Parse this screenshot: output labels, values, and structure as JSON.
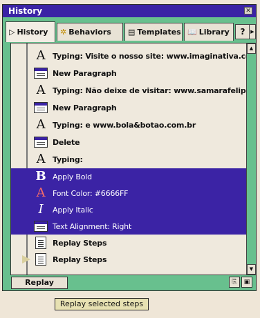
{
  "window": {
    "title": "History",
    "close_glyph": "✕"
  },
  "tabs": [
    {
      "label": "History",
      "icon": "play-triangle-icon",
      "glyph": "▷"
    },
    {
      "label": "Behaviors",
      "icon": "gear-icon",
      "glyph": "✲"
    },
    {
      "label": "Templates",
      "icon": "template-icon",
      "glyph": "▤"
    },
    {
      "label": "Library",
      "icon": "book-icon",
      "glyph": "📖"
    }
  ],
  "help": {
    "glyph": "?"
  },
  "tab_scroll": {
    "glyph": "▶"
  },
  "history_items": [
    {
      "label": "Typing: Visite o nosso site: www.imaginativa.com.br",
      "icon": "typing-icon",
      "selected": false
    },
    {
      "label": "New Paragraph",
      "icon": "paragraph-icon",
      "selected": false
    },
    {
      "label": "Typing: Não deixe de visitar: www.samarafelippo.com.br",
      "icon": "typing-icon",
      "selected": false
    },
    {
      "label": "New Paragraph",
      "icon": "paragraph-icon",
      "selected": false
    },
    {
      "label": "Typing: e www.bola&botao.com.br",
      "icon": "typing-icon",
      "selected": false
    },
    {
      "label": "Delete",
      "icon": "paragraph-icon",
      "selected": false
    },
    {
      "label": "Typing:",
      "icon": "typing-icon",
      "selected": false
    },
    {
      "label": "Apply Bold",
      "icon": "bold-icon",
      "selected": true
    },
    {
      "label": "Font Color: #6666FF",
      "icon": "font-color-icon",
      "selected": true
    },
    {
      "label": "Apply Italic",
      "icon": "italic-icon",
      "selected": true
    },
    {
      "label": "Text Alignment: Right",
      "icon": "paragraph-icon",
      "selected": true
    },
    {
      "label": "Replay Steps",
      "icon": "replay-steps-icon",
      "selected": false
    },
    {
      "label": "Replay Steps",
      "icon": "replay-steps-icon",
      "selected": false
    }
  ],
  "scrollbar": {
    "up_glyph": "▲",
    "down_glyph": "▼"
  },
  "footer": {
    "replay_label": "Replay",
    "copy_glyph": "⎘",
    "save_glyph": "▣"
  },
  "tooltip": {
    "text": "Replay selected steps"
  }
}
